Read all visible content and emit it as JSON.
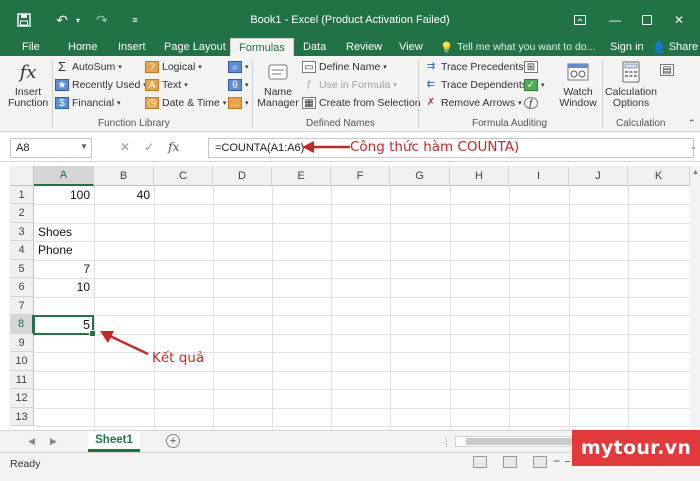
{
  "window": {
    "title": "Book1 - Excel (Product Activation Failed)"
  },
  "tabs": [
    "File",
    "Home",
    "Insert",
    "Page Layout",
    "Formulas",
    "Data",
    "Review",
    "View"
  ],
  "active_tab": "Formulas",
  "tell_me": "Tell me what you want to do...",
  "sign_in": "Sign in",
  "share": "Share",
  "ribbon": {
    "insert_function": [
      "Insert",
      "Function"
    ],
    "function_library": {
      "autosum": "AutoSum",
      "recently_used": "Recently Used",
      "financial": "Financial",
      "logical": "Logical",
      "text": "Text",
      "date_time": "Date & Time",
      "label": "Function Library"
    },
    "defined_names": {
      "name_manager": [
        "Name",
        "Manager"
      ],
      "define_name": "Define Name",
      "use_in_formula": "Use in Formula",
      "create_from_selection": "Create from Selection",
      "label": "Defined Names"
    },
    "formula_auditing": {
      "trace_precedents": "Trace Precedents",
      "trace_dependents": "Trace Dependents",
      "remove_arrows": "Remove Arrows",
      "watch_window": [
        "Watch",
        "Window"
      ],
      "label": "Formula Auditing"
    },
    "calculation": {
      "calc_options": [
        "Calculation",
        "Options"
      ],
      "label": "Calculation"
    }
  },
  "formula_bar": {
    "name_box": "A8",
    "formula": "=COUNTA(A1:A6)",
    "annotation": "Công thức hàm COUNTA)"
  },
  "grid": {
    "columns": [
      "A",
      "B",
      "C",
      "D",
      "E",
      "F",
      "G",
      "H",
      "I",
      "J",
      "K"
    ],
    "rows": [
      "1",
      "2",
      "3",
      "4",
      "5",
      "6",
      "7",
      "8",
      "9",
      "10",
      "11",
      "12",
      "13"
    ],
    "cells": {
      "A1": "100",
      "B1": "40",
      "A3": "Shoes",
      "A4": "Phone",
      "A5": "7",
      "A6": "10",
      "A8": "5"
    },
    "selected_cell": "A8",
    "annotation": "Kết quả"
  },
  "sheet": {
    "name": "Sheet1"
  },
  "status": "Ready",
  "watermark": "mytour.vn",
  "colors": {
    "excel_green": "#217346",
    "annotation_red": "#c62828",
    "watermark_red": "#e23a3a"
  }
}
